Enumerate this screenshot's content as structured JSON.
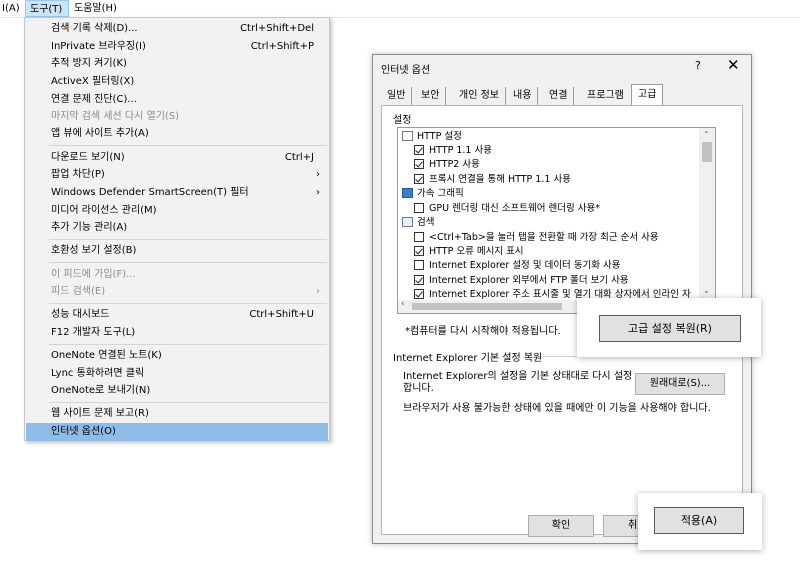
{
  "menubar": {
    "items": [
      {
        "label": "I(A)"
      },
      {
        "label": "도구(T)"
      },
      {
        "label": "도움말(H)"
      }
    ]
  },
  "tools_menu": {
    "items": [
      {
        "label": "검색 기록 삭제(D)...",
        "shortcut": "Ctrl+Shift+Del",
        "disabled": false
      },
      {
        "label": "InPrivate 브라우징(I)",
        "shortcut": "Ctrl+Shift+P",
        "disabled": false
      },
      {
        "label": "추적 방지 켜기(K)",
        "shortcut": "",
        "disabled": false
      },
      {
        "label": "ActiveX 필터링(X)",
        "shortcut": "",
        "disabled": false
      },
      {
        "label": "연결 문제 진단(C)...",
        "shortcut": "",
        "disabled": false
      },
      {
        "label": "마지막 검색 세션 다시 열기(S)",
        "shortcut": "",
        "disabled": true
      },
      {
        "label": "앱 뷰에 사이트 추가(A)",
        "shortcut": "",
        "disabled": false
      },
      {
        "label": "다운로드 보기(N)",
        "shortcut": "Ctrl+J",
        "disabled": false
      },
      {
        "label": "팝업 차단(P)",
        "shortcut": "",
        "submenu": true,
        "disabled": false
      },
      {
        "label": "Windows Defender SmartScreen(T) 필터",
        "shortcut": "",
        "submenu": true,
        "disabled": false
      },
      {
        "label": "미디어 라이선스 관리(M)",
        "shortcut": "",
        "disabled": false
      },
      {
        "label": "추가 기능 관리(A)",
        "shortcut": "",
        "disabled": false
      },
      {
        "label": "호환성 보기 설정(B)",
        "shortcut": "",
        "disabled": false
      },
      {
        "label": "이 피드에 가입(F)...",
        "shortcut": "",
        "disabled": true
      },
      {
        "label": "피드 검색(E)",
        "shortcut": "",
        "submenu": true,
        "disabled": true
      },
      {
        "label": "성능 대시보드",
        "shortcut": "Ctrl+Shift+U",
        "disabled": false
      },
      {
        "label": "F12 개발자 도구(L)",
        "shortcut": "",
        "disabled": false
      },
      {
        "label": "OneNote 연결된 노트(K)",
        "shortcut": "",
        "disabled": false
      },
      {
        "label": "Lync 통화하려면 클릭",
        "shortcut": "",
        "disabled": false
      },
      {
        "label": "OneNote로 보내기(N)",
        "shortcut": "",
        "disabled": false
      },
      {
        "label": "웹 사이트 문제 보고(R)",
        "shortcut": "",
        "disabled": false
      },
      {
        "label": "인터넷 옵션(O)",
        "shortcut": "",
        "disabled": false,
        "selected": true
      }
    ],
    "submenu_arrow": "›"
  },
  "dialog": {
    "title": "인터넷 옵션",
    "help": "?",
    "close": "✕",
    "tabs": [
      "일반",
      "보안",
      "개인 정보",
      "내용",
      "연결",
      "프로그램",
      "고급"
    ],
    "active_tab": "고급",
    "settings_label": "설정",
    "settings": [
      {
        "type": "category",
        "label": "HTTP 설정"
      },
      {
        "type": "check",
        "label": "HTTP 1.1 사용",
        "checked": true
      },
      {
        "type": "check",
        "label": "HTTP2 사용",
        "checked": true
      },
      {
        "type": "check",
        "label": "프록시 연결을 통해 HTTP 1.1 사용",
        "checked": true
      },
      {
        "type": "category",
        "label": "가속 그래픽"
      },
      {
        "type": "check",
        "label": "GPU 렌더링 대신 소프트웨어 렌더링 사용*",
        "checked": false
      },
      {
        "type": "category",
        "label": "검색"
      },
      {
        "type": "check",
        "label": "<Ctrl+Tab>을 눌러 탭을 전환할 때 가장 최근 순서 사용",
        "checked": false
      },
      {
        "type": "check",
        "label": "HTTP 오류 메시지 표시",
        "checked": true
      },
      {
        "type": "check",
        "label": "Internet Explorer 설정 및 데이터 동기화 사용",
        "checked": false
      },
      {
        "type": "check",
        "label": "Internet Explorer 외부에서 FTP 폴더 보기 사용",
        "checked": true
      },
      {
        "type": "check",
        "label": "Internet Explorer 주소 표시줄 및 열기 대화 상자에서 인라인 자",
        "checked": true
      }
    ],
    "restart_note": "*컴퓨터를 다시 시작해야 적용됩니다.",
    "restore_advanced_button": "고급 설정 복원(R)",
    "reset_group_label": "Internet Explorer 기본 설정 복원",
    "reset_description": "Internet Explorer의 설정을 기본 상태대로 다시 설정합니다.",
    "reset_button": "원래대로(S)...",
    "reset_warning": "브라우저가 사용 불가능한 상태에 있을 때에만 이 기능을 사용해야 합니다.",
    "ok_button": "확인",
    "cancel_partial": "취",
    "apply_button": "적용(A)"
  }
}
